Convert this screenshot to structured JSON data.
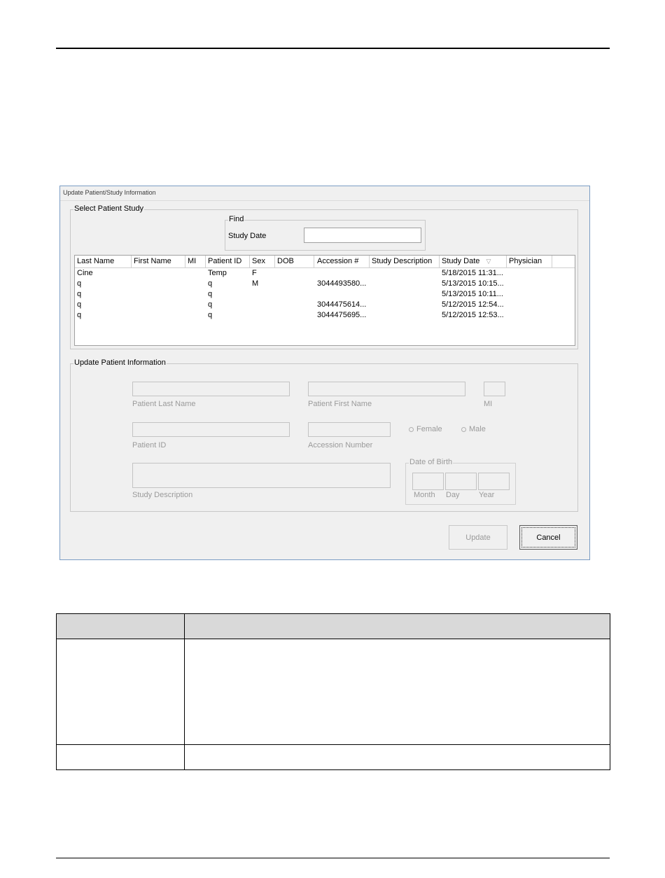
{
  "dialog": {
    "title": "Update Patient/Study Information",
    "select_group": {
      "label": "Select Patient Study",
      "find": {
        "label": "Find",
        "study_date_label": "Study Date",
        "study_date_value": ""
      },
      "columns": [
        "Last Name",
        "First Name",
        "MI",
        "Patient ID",
        "Sex",
        "DOB",
        "Accession #",
        "Study Description",
        "Study Date",
        "Physician"
      ],
      "sort_indicator": "▽",
      "rows": [
        {
          "last_name": "Cine",
          "first_name": "",
          "mi": "",
          "patient_id": "Temp",
          "sex": "F",
          "dob": "",
          "accession": "",
          "study_description": "",
          "study_date": "5/18/2015 11:31...",
          "physician": ""
        },
        {
          "last_name": "q",
          "first_name": "",
          "mi": "",
          "patient_id": "q",
          "sex": "M",
          "dob": "",
          "accession": "3044493580...",
          "study_description": "",
          "study_date": "5/13/2015 10:15...",
          "physician": ""
        },
        {
          "last_name": "q",
          "first_name": "",
          "mi": "",
          "patient_id": "q",
          "sex": "",
          "dob": "",
          "accession": "",
          "study_description": "",
          "study_date": "5/13/2015 10:11...",
          "physician": ""
        },
        {
          "last_name": "q",
          "first_name": "",
          "mi": "",
          "patient_id": "q",
          "sex": "",
          "dob": "",
          "accession": "3044475614...",
          "study_description": "",
          "study_date": "5/12/2015 12:54...",
          "physician": ""
        },
        {
          "last_name": "q",
          "first_name": "",
          "mi": "",
          "patient_id": "q",
          "sex": "",
          "dob": "",
          "accession": "3044475695...",
          "study_description": "",
          "study_date": "5/12/2015 12:53...",
          "physician": ""
        }
      ]
    },
    "update_group": {
      "label": "Update Patient Information",
      "patient_last_name_label": "Patient Last Name",
      "patient_first_name_label": "Patient First Name",
      "mi_label": "MI",
      "patient_id_label": "Patient ID",
      "accession_label": "Accession Number",
      "female_label": "Female",
      "male_label": "Male",
      "study_description_label": "Study Description",
      "dob": {
        "label": "Date of Birth",
        "month_label": "Month",
        "day_label": "Day",
        "year_label": "Year"
      }
    },
    "buttons": {
      "update": "Update",
      "cancel": "Cancel"
    }
  }
}
